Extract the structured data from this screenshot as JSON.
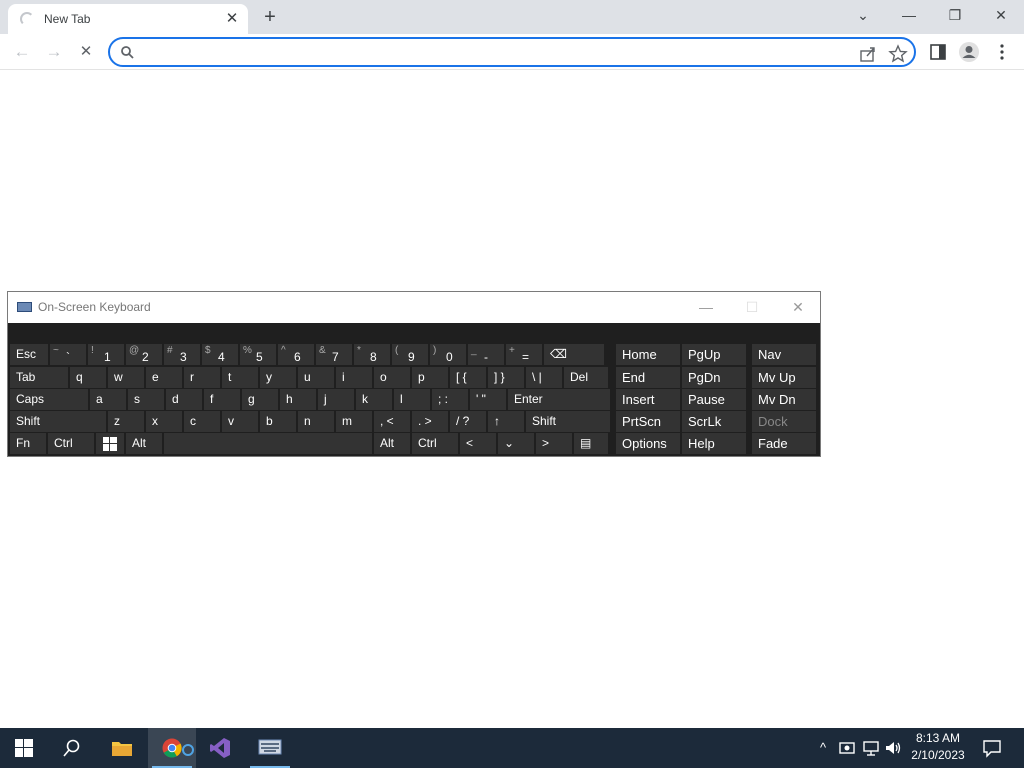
{
  "browser": {
    "tab_title": "New Tab",
    "tab_close": "✕",
    "new_tab": "+",
    "omnibox": {
      "value": "",
      "placeholder": ""
    },
    "window_controls": {
      "dropdown": "⌄",
      "minimize": "—",
      "restore": "❐",
      "close": "✕"
    },
    "nav": {
      "back": "←",
      "forward": "→",
      "stop": "✕"
    }
  },
  "osk": {
    "title": "On-Screen Keyboard",
    "controls": {
      "minimize": "—",
      "maximize": "☐",
      "close": "✕"
    },
    "row1": [
      {
        "main": "Esc"
      },
      {
        "shift": "~",
        "main": "`"
      },
      {
        "shift": "!",
        "main": "1"
      },
      {
        "shift": "@",
        "main": "2"
      },
      {
        "shift": "#",
        "main": "3"
      },
      {
        "shift": "$",
        "main": "4"
      },
      {
        "shift": "%",
        "main": "5"
      },
      {
        "shift": "^",
        "main": "6"
      },
      {
        "shift": "&",
        "main": "7"
      },
      {
        "shift": "*",
        "main": "8"
      },
      {
        "shift": "(",
        "main": "9"
      },
      {
        "shift": ")",
        "main": "0"
      },
      {
        "shift": "_",
        "main": "-"
      },
      {
        "shift": "+",
        "main": "="
      },
      {
        "main": "⌫"
      }
    ],
    "row2": [
      "Tab",
      "q",
      "w",
      "e",
      "r",
      "t",
      "y",
      "u",
      "i",
      "o",
      "p",
      "[ {",
      "] }",
      "\\ |",
      "Del"
    ],
    "row3": [
      "Caps",
      "a",
      "s",
      "d",
      "f",
      "g",
      "h",
      "j",
      "k",
      "l",
      "; :",
      "' \"",
      "Enter"
    ],
    "row4": [
      "Shift",
      "z",
      "x",
      "c",
      "v",
      "b",
      "n",
      "m",
      ", <",
      ". >",
      "/ ?",
      "↑",
      "Shift"
    ],
    "row5": {
      "fn": "Fn",
      "ctrl": "Ctrl",
      "alt": "Alt",
      "alt2": "Alt",
      "ctrl2": "Ctrl",
      "left": "<",
      "down": "⌄",
      "right": ">",
      "menu": "▤"
    },
    "nav_keys": [
      [
        "Home",
        "PgUp",
        "Nav"
      ],
      [
        "End",
        "PgDn",
        "Mv Up"
      ],
      [
        "Insert",
        "Pause",
        "Mv Dn"
      ],
      [
        "PrtScn",
        "ScrLk",
        "Dock"
      ],
      [
        "Options",
        "Help",
        "Fade"
      ]
    ]
  },
  "taskbar": {
    "time": "8:13 AM",
    "date": "2/10/2023",
    "accent": "#76b9ed"
  }
}
